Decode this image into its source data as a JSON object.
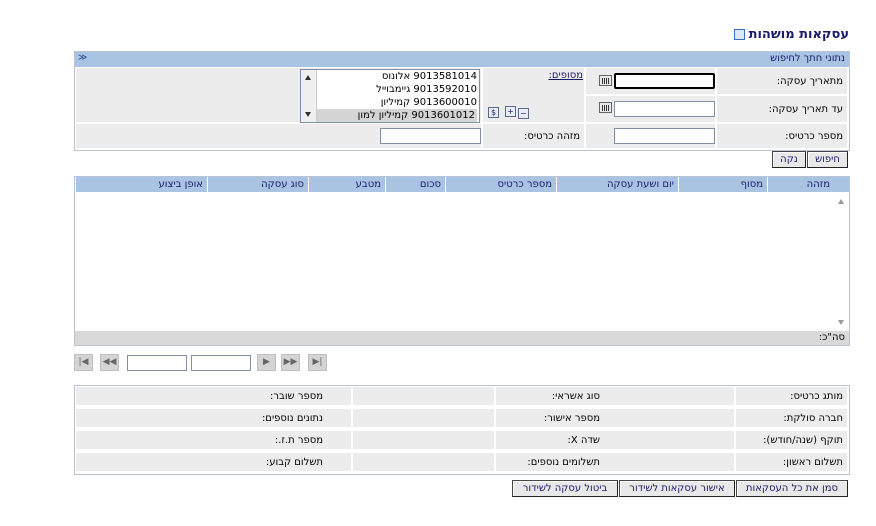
{
  "page": {
    "title": "עסקאות מושהות"
  },
  "search": {
    "header": "נתוני חתך לחיפוש",
    "from_date_label": "מתאריך עסקה:",
    "to_date_label": "עד תאריך עסקה:",
    "card_number_label": "מספר כרטיס:",
    "card_id_label": "מזהה כרטיס:",
    "terminals_label": "מסופים:",
    "from_date_value": "",
    "to_date_value": "",
    "card_number_value": "",
    "card_id_value": "",
    "terminals": [
      {
        "label": "9013581014 אלונוס",
        "selected": false
      },
      {
        "label": "9013592010 גיימבוייל",
        "selected": false
      },
      {
        "label": "9013600010 קמיליון",
        "selected": false
      },
      {
        "label": "9013601012 קמיליון למון",
        "selected": true
      }
    ],
    "search_button": "חיפוש",
    "clear_button": "נקה"
  },
  "grid": {
    "columns": [
      "מזהה",
      "מסוף",
      "יום ושעת עסקה",
      "מספר כרטיס",
      "סכום",
      "מטבע",
      "סוג עסקה",
      "אופן ביצוע"
    ],
    "rows": [],
    "total_label": "סה\"כ:"
  },
  "pager": {
    "page_value": "",
    "total_value": ""
  },
  "details": {
    "card_brand": "מותג כרטיס:",
    "credit_type": "סוג אשראי:",
    "voucher_number": "מספר שובר:",
    "clearing_company": "חברה סולקת:",
    "approval_number": "מספר אישור:",
    "additional_data": "נתונים נוספים:",
    "validity": "תוקף (שנה/חודש):",
    "field_x": "שדה X:",
    "id_number": "מספר ת.ז.:",
    "first_payment": "תשלום ראשון:",
    "additional_payments": "תשלומים נוספים:",
    "fixed_payment": "תשלום קבוע:"
  },
  "actions": {
    "select_all": "סמן את כל העסקאות",
    "approve_transmit": "אישור עסקאות לשידור",
    "cancel_transmit": "ביטול עסקה לשידור"
  },
  "colors": {
    "header_blue": "#a9c3e3",
    "title_navy": "#1a1a6a",
    "cell_gray": "#ececec"
  }
}
